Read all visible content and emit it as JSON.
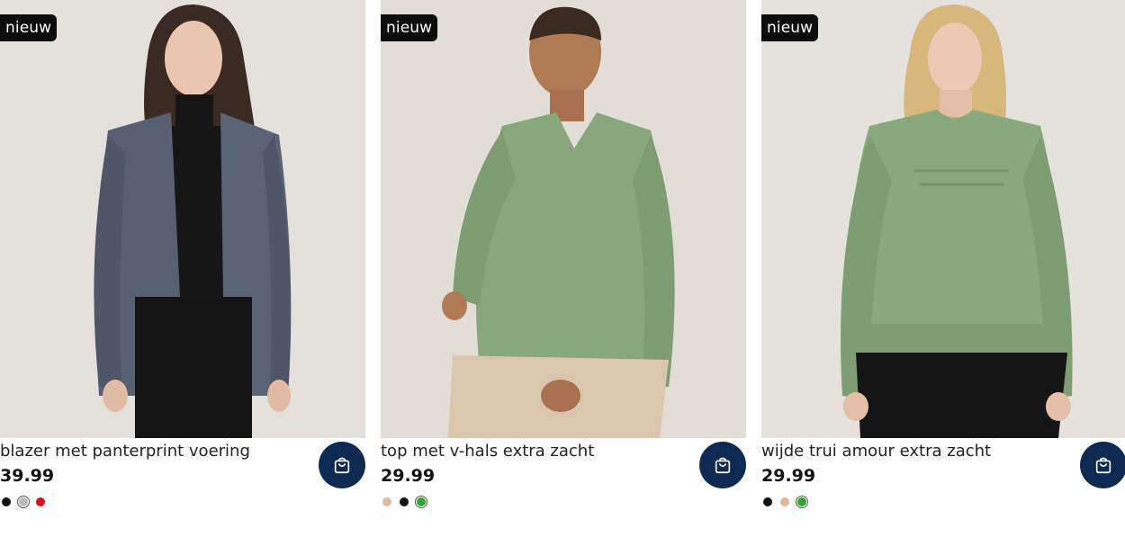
{
  "products": [
    {
      "badge": "nieuw",
      "title": "blazer met panterprint voering",
      "price": "39.99",
      "image": "woman-in-grey-blazer-black-turtleneck",
      "swatches": [
        {
          "color": "#111111",
          "selected": false
        },
        {
          "color": "#b9b9b9",
          "selected": true
        },
        {
          "color": "#e01010",
          "selected": false
        }
      ]
    },
    {
      "badge": "nieuw",
      "title": "top met v-hals extra zacht",
      "price": "29.99",
      "image": "woman-in-green-v-neck-top-beige-trousers",
      "swatches": [
        {
          "color": "#e2b99a",
          "selected": false
        },
        {
          "color": "#111111",
          "selected": false
        },
        {
          "color": "#2da82d",
          "selected": true
        }
      ]
    },
    {
      "badge": "nieuw",
      "title": "wijde trui amour extra zacht",
      "price": "29.99",
      "image": "woman-in-green-amour-sweater-black-trousers",
      "swatches": [
        {
          "color": "#111111",
          "selected": false
        },
        {
          "color": "#e2b99a",
          "selected": false
        },
        {
          "color": "#2da82d",
          "selected": true
        }
      ]
    }
  ],
  "cart_icon": "shopping-bag-icon",
  "colors": {
    "cart_button": "#0f2a52",
    "badge_bg": "#0d0d0d"
  }
}
